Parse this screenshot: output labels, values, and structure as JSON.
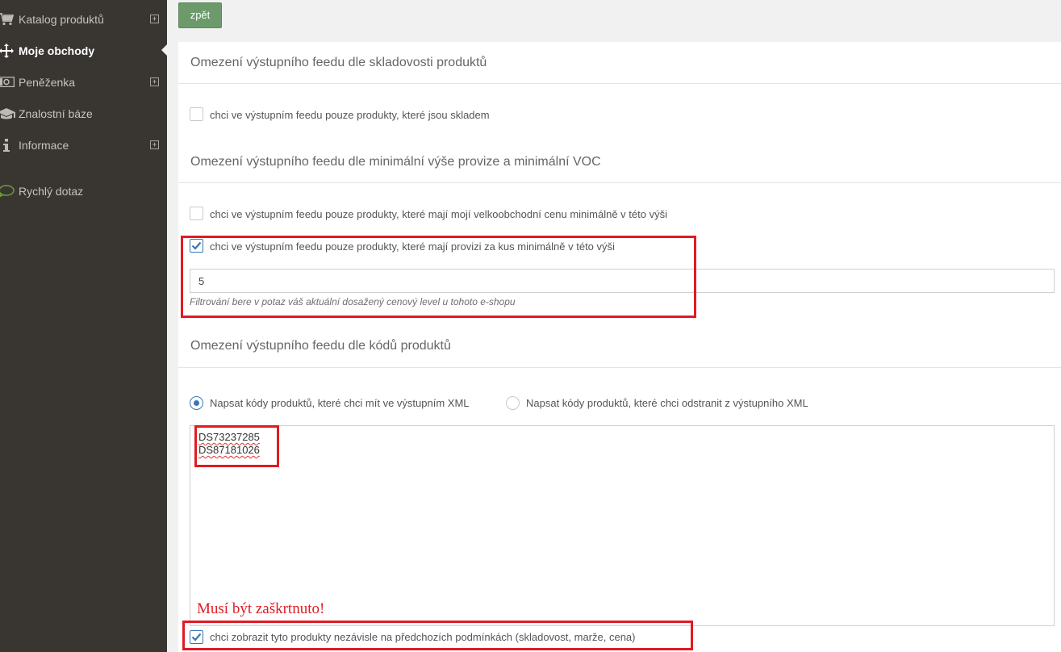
{
  "sidebar": {
    "items": [
      {
        "label": "Katalog produktů",
        "icon": "cart-icon",
        "expandable": true
      },
      {
        "label": "Moje obchody",
        "icon": "arrows-move-icon",
        "active": true
      },
      {
        "label": "Peněženka",
        "icon": "banknote-icon",
        "expandable": true
      },
      {
        "label": "Znalostní báze",
        "icon": "graduation-cap-icon"
      },
      {
        "label": "Informace",
        "icon": "info-icon",
        "expandable": true
      }
    ],
    "quick": {
      "label": "Rychlý dotaz",
      "icon": "speech-bubble-icon"
    }
  },
  "back_button": "zpět",
  "stock_section": {
    "title": "Omezení výstupního feedu dle skladovosti produktů",
    "in_stock_label": "chci ve výstupním feedu pouze produkty, které jsou skladem",
    "in_stock_checked": false
  },
  "commission_section": {
    "title": "Omezení výstupního feedu dle minimální výše provize a minimální VOC",
    "wholesale_label": "chci ve výstupním feedu pouze produkty, které mají mojí velkoobchodní cenu minimálně v této výši",
    "wholesale_checked": false,
    "commission_label": "chci ve výstupním feedu pouze produkty, které mají provizi za kus minimálně v této výši",
    "commission_checked": true,
    "commission_value": "5",
    "help_text": "Filtrování bere v potaz váš aktuální dosažený cenový level u tohoto e-shopu"
  },
  "codes_section": {
    "title": "Omezení výstupního feedu dle kódů produktů",
    "radio_include_label": "Napsat kódy produktů, které chci mít ve výstupním XML",
    "radio_exclude_label": "Napsat kódy produktů, které chci odstranit z výstupního XML",
    "selected": "include",
    "codes": [
      "DS73237285",
      "DS87181026"
    ],
    "annotation": "Musí být zaškrtnuto!",
    "force_label": "chci zobrazit tyto produkty nezávisle na předchozích podmínkách (skladovost, marže, cena)",
    "force_checked": true
  },
  "colors": {
    "sidebar_bg": "#393632",
    "back_button": "#6c9a6a",
    "highlight": "#e11a22",
    "checkbox_accent": "#3a76b4"
  }
}
